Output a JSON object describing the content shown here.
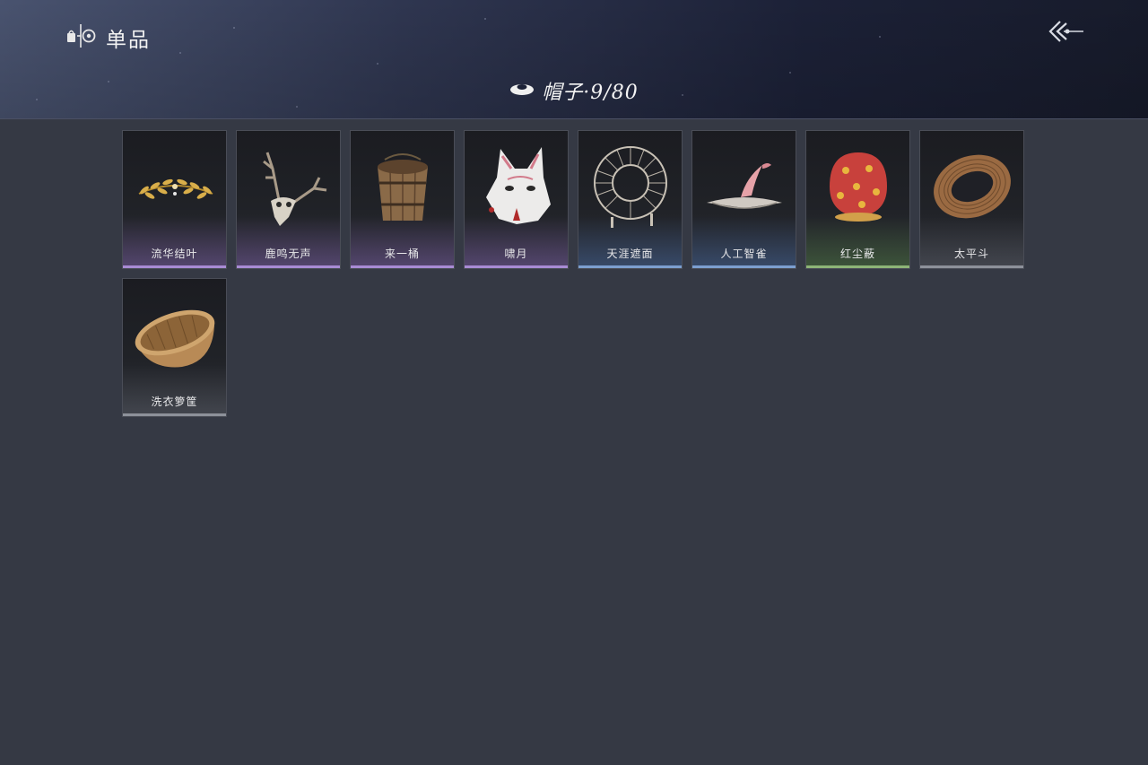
{
  "header": {
    "title": "单品",
    "title_icon": "wardrobe-icon",
    "back_icon": "back-arrow-icon"
  },
  "category": {
    "icon": "hat-icon",
    "label": "帽子·9/80"
  },
  "items": [
    {
      "name": "流华结叶",
      "rarity": "purple",
      "icon": "golden-laurel-wreath"
    },
    {
      "name": "鹿鸣无声",
      "rarity": "purple",
      "icon": "deer-skull-antlers"
    },
    {
      "name": "来一桶",
      "rarity": "purple",
      "icon": "wooden-bucket"
    },
    {
      "name": "啸月",
      "rarity": "purple",
      "icon": "white-fox-mask"
    },
    {
      "name": "天涯遮面",
      "rarity": "blue",
      "icon": "bamboo-frame-veil"
    },
    {
      "name": "人工智雀",
      "rarity": "blue",
      "icon": "bird-hat"
    },
    {
      "name": "红尘蔽",
      "rarity": "green",
      "icon": "red-floral-hood"
    },
    {
      "name": "太平斗",
      "rarity": "gray",
      "icon": "wicker-basket-hat"
    },
    {
      "name": "洗衣箩筐",
      "rarity": "gray",
      "icon": "laundry-wicker-basket"
    }
  ],
  "colors": {
    "background": "#353944",
    "rarity_purple": "#a98bd4",
    "rarity_blue": "#7c9fd0",
    "rarity_green": "#8db477",
    "rarity_gray": "#8d919a"
  }
}
